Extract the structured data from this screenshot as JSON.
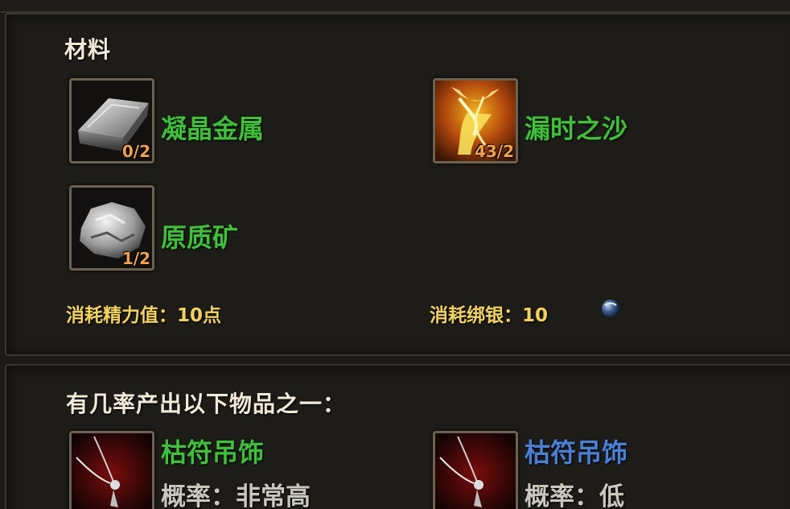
{
  "materials": {
    "title": "材料",
    "items": [
      {
        "name": "凝晶金属",
        "count": "0/2",
        "icon": "metal-ingot-icon",
        "name_color": "#3fbf3a"
      },
      {
        "name": "漏时之沙",
        "count": "43/2",
        "icon": "hourglass-sand-icon",
        "name_color": "#3fbf3a"
      },
      {
        "name": "原质矿",
        "count": "1/2",
        "icon": "raw-ore-icon",
        "name_color": "#3fbf3a"
      }
    ],
    "stamina_cost_label": "消耗精力值：",
    "stamina_cost_value": "10点",
    "silver_cost_label": "消耗绑银：",
    "silver_cost_value": "10",
    "silver_icon": "bound-silver-coin-icon"
  },
  "outputs": {
    "title": "有几率产出以下物品之一：",
    "items": [
      {
        "name": "枯符吊饰",
        "prob_label": "概率：",
        "prob_value": "非常高",
        "icon": "pendant-icon",
        "name_color": "#3fbf3a"
      },
      {
        "name": "枯符吊饰",
        "prob_label": "概率：",
        "prob_value": "低",
        "icon": "pendant-icon",
        "name_color": "#4a7fd6"
      }
    ]
  }
}
